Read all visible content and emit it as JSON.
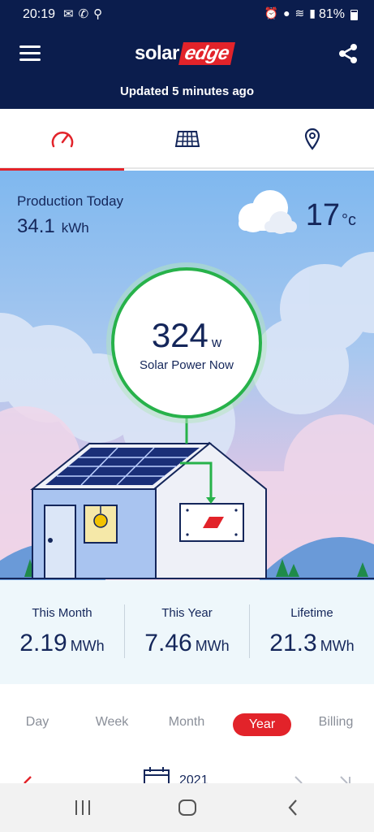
{
  "status_bar": {
    "time": "20:19",
    "battery": "81%"
  },
  "app_bar": {
    "logo_solar": "solar",
    "logo_edge": "edge",
    "updated": "Updated 5 minutes ago"
  },
  "tabs": [
    {
      "name": "dashboard",
      "icon": "speedometer-icon",
      "active": true
    },
    {
      "name": "layout",
      "icon": "solar-panel-grid-icon",
      "active": false
    },
    {
      "name": "location",
      "icon": "location-pin-icon",
      "active": false
    }
  ],
  "production": {
    "label": "Production Today",
    "value": "34.1",
    "unit": "kWh"
  },
  "weather": {
    "temperature": "17",
    "unit": "°c",
    "icon": "cloud-icon"
  },
  "power_now": {
    "value": "324",
    "unit": "w",
    "label": "Solar Power Now"
  },
  "stats": [
    {
      "label": "This Month",
      "value": "2.19",
      "unit": "MWh"
    },
    {
      "label": "This Year",
      "value": "7.46",
      "unit": "MWh"
    },
    {
      "label": "Lifetime",
      "value": "21.3",
      "unit": "MWh"
    }
  ],
  "periods": [
    "Day",
    "Week",
    "Month",
    "Year",
    "Billing"
  ],
  "selected_period": "Year",
  "date_selector": {
    "year": "2021"
  },
  "colors": {
    "navy": "#0b1d4d",
    "brand_red": "#e2232a",
    "green": "#27b24a",
    "text_navy": "#14265a"
  }
}
